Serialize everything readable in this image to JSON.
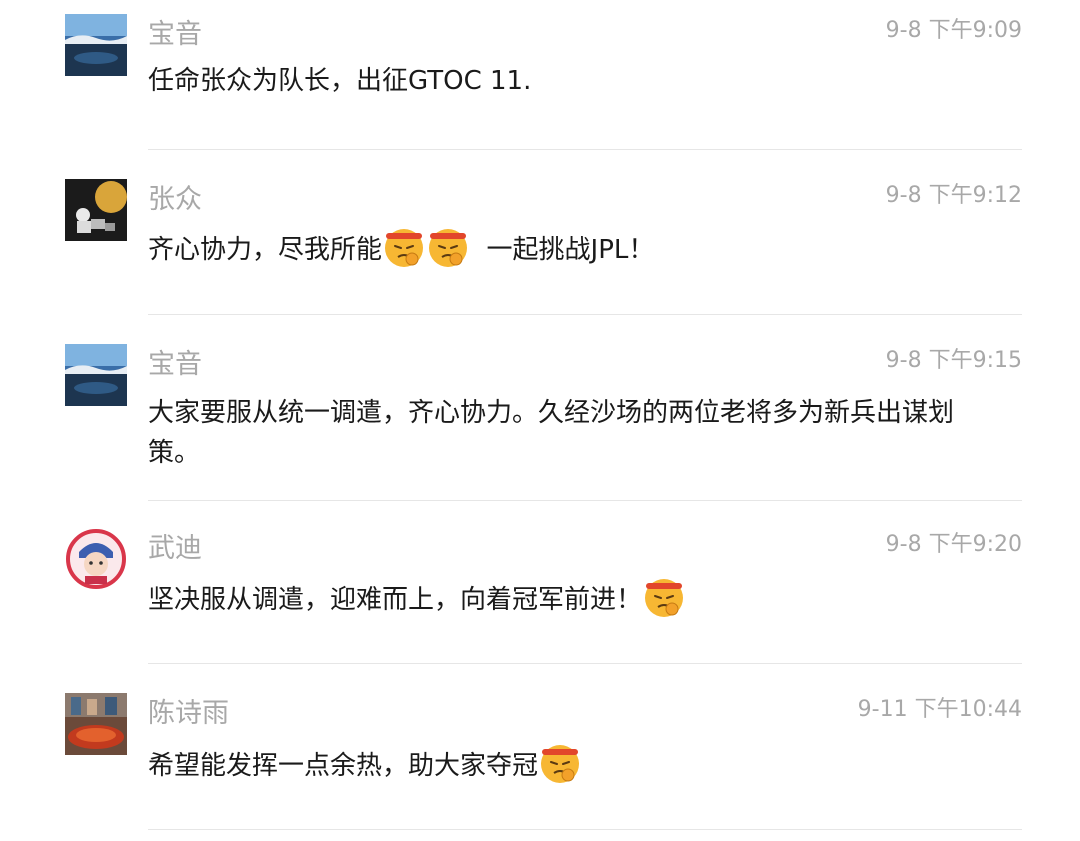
{
  "messages": [
    {
      "name": "宝音",
      "time": "9-8 下午9:09",
      "avatar": "landscape-avatar",
      "parts": [
        "任命张众为队长，出征GTOC 11."
      ]
    },
    {
      "name": "张众",
      "time": "9-8 下午9:12",
      "avatar": "astronaut-moon-avatar",
      "parts": [
        "齐心协力，尽我所能",
        "fighting-emoji",
        "fighting-emoji",
        "  一起挑战JPL！"
      ]
    },
    {
      "name": "宝音",
      "time": "9-8 下午9:15",
      "avatar": "landscape-avatar",
      "parts": [
        "大家要服从统一调遣，齐心协力。久经沙场的两位老将多为新兵出谋划策。"
      ]
    },
    {
      "name": "武迪",
      "time": "9-8 下午9:20",
      "avatar": "cartoon-avatar",
      "parts": [
        "坚决服从调遣，迎难而上，向着冠军前进！",
        "fighting-emoji"
      ]
    },
    {
      "name": "陈诗雨",
      "time": "9-11 下午10:44",
      "avatar": "food-photo-avatar",
      "parts": [
        "希望能发挥一点余热，助大家夺冠",
        "fighting-emoji"
      ]
    }
  ],
  "colors": {
    "meta_text": "#a8a8a8",
    "body_text": "#1a1a1a",
    "divider": "#e6e6e6",
    "emoji_face": "#f7b733"
  }
}
